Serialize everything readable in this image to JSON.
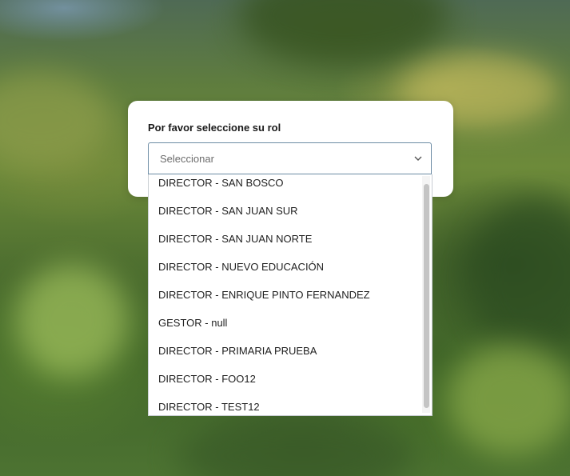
{
  "role_selector": {
    "label": "Por favor seleccione su rol",
    "placeholder": "Seleccionar",
    "options": [
      "DIRECTOR - SAN BOSCO",
      "DIRECTOR - SAN JUAN SUR",
      "DIRECTOR - SAN JUAN NORTE",
      "DIRECTOR - NUEVO EDUCACIÓN",
      "DIRECTOR - ENRIQUE PINTO FERNANDEZ",
      "GESTOR - null",
      "DIRECTOR - PRIMARIA PRUEBA",
      "DIRECTOR - FOO12",
      "DIRECTOR - TEST12"
    ]
  },
  "icons": {
    "dropdown_toggle": "chevron-down-icon"
  },
  "colors": {
    "card_background": "#ffffff",
    "select_border": "#6b8ba4",
    "text": "#1f1f1f",
    "placeholder": "#6c6c6c"
  }
}
